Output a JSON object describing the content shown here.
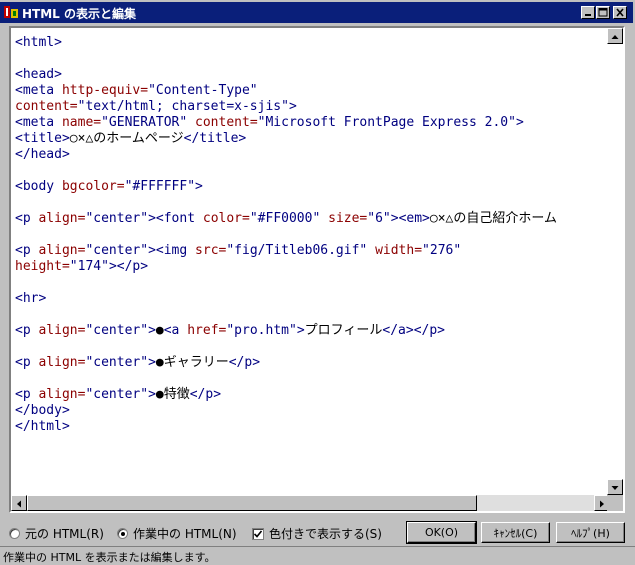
{
  "window": {
    "title": "HTML の表示と編集",
    "app_icon": "frontpage-express-icon",
    "controls": [
      "minimize-icon",
      "maximize-icon",
      "close-icon"
    ]
  },
  "colors": {
    "titlebar": "#0a1f7a",
    "tag": "#000080",
    "attribute": "#8b0000",
    "value": "#000080",
    "text": "#000000"
  },
  "editor": {
    "lines": [
      [
        {
          "t": "tag",
          "s": "<html>"
        }
      ],
      [],
      [
        {
          "t": "tag",
          "s": "<head>"
        }
      ],
      [
        {
          "t": "tag",
          "s": "<meta "
        },
        {
          "t": "attr",
          "s": "http-equiv="
        },
        {
          "t": "val",
          "s": "\"Content-Type\""
        }
      ],
      [
        {
          "t": "attr",
          "s": "content="
        },
        {
          "t": "val",
          "s": "\"text/html; charset=x-sjis\""
        },
        {
          "t": "tag",
          "s": ">"
        }
      ],
      [
        {
          "t": "tag",
          "s": "<meta "
        },
        {
          "t": "attr",
          "s": "name="
        },
        {
          "t": "val",
          "s": "\"GENERATOR\""
        },
        {
          "t": "tag",
          "s": " "
        },
        {
          "t": "attr",
          "s": "content="
        },
        {
          "t": "val",
          "s": "\"Microsoft FrontPage Express 2.0\""
        },
        {
          "t": "tag",
          "s": ">"
        }
      ],
      [
        {
          "t": "tag",
          "s": "<title>"
        },
        {
          "t": "plain",
          "s": "○×△のホームページ"
        },
        {
          "t": "tag",
          "s": "</title>"
        }
      ],
      [
        {
          "t": "tag",
          "s": "</head>"
        }
      ],
      [],
      [
        {
          "t": "tag",
          "s": "<body "
        },
        {
          "t": "attr",
          "s": "bgcolor="
        },
        {
          "t": "val",
          "s": "\"#FFFFFF\""
        },
        {
          "t": "tag",
          "s": ">"
        }
      ],
      [],
      [
        {
          "t": "tag",
          "s": "<p "
        },
        {
          "t": "attr",
          "s": "align="
        },
        {
          "t": "val",
          "s": "\"center\""
        },
        {
          "t": "tag",
          "s": "><font "
        },
        {
          "t": "attr",
          "s": "color="
        },
        {
          "t": "val",
          "s": "\"#FF0000\""
        },
        {
          "t": "tag",
          "s": " "
        },
        {
          "t": "attr",
          "s": "size="
        },
        {
          "t": "val",
          "s": "\"6\""
        },
        {
          "t": "tag",
          "s": "><em>"
        },
        {
          "t": "plain",
          "s": "○×△の自己紹介ホーム"
        }
      ],
      [],
      [
        {
          "t": "tag",
          "s": "<p "
        },
        {
          "t": "attr",
          "s": "align="
        },
        {
          "t": "val",
          "s": "\"center\""
        },
        {
          "t": "tag",
          "s": "><img "
        },
        {
          "t": "attr",
          "s": "src="
        },
        {
          "t": "val",
          "s": "\"fig/Titleb06.gif\""
        },
        {
          "t": "tag",
          "s": " "
        },
        {
          "t": "attr",
          "s": "width="
        },
        {
          "t": "val",
          "s": "\"276\""
        }
      ],
      [
        {
          "t": "attr",
          "s": "height="
        },
        {
          "t": "val",
          "s": "\"174\""
        },
        {
          "t": "tag",
          "s": "></p>"
        }
      ],
      [],
      [
        {
          "t": "tag",
          "s": "<hr>"
        }
      ],
      [],
      [
        {
          "t": "tag",
          "s": "<p "
        },
        {
          "t": "attr",
          "s": "align="
        },
        {
          "t": "val",
          "s": "\"center\""
        },
        {
          "t": "tag",
          "s": ">"
        },
        {
          "t": "plain",
          "s": "●"
        },
        {
          "t": "tag",
          "s": "<a "
        },
        {
          "t": "attr",
          "s": "href="
        },
        {
          "t": "val",
          "s": "\"pro.htm\""
        },
        {
          "t": "tag",
          "s": ">"
        },
        {
          "t": "plain",
          "s": "プロフィール"
        },
        {
          "t": "tag",
          "s": "</a></p>"
        }
      ],
      [],
      [
        {
          "t": "tag",
          "s": "<p "
        },
        {
          "t": "attr",
          "s": "align="
        },
        {
          "t": "val",
          "s": "\"center\""
        },
        {
          "t": "tag",
          "s": ">"
        },
        {
          "t": "plain",
          "s": "●ギャラリー"
        },
        {
          "t": "tag",
          "s": "</p>"
        }
      ],
      [],
      [
        {
          "t": "tag",
          "s": "<p "
        },
        {
          "t": "attr",
          "s": "align="
        },
        {
          "t": "val",
          "s": "\"center\""
        },
        {
          "t": "tag",
          "s": ">"
        },
        {
          "t": "plain",
          "s": "●特徴"
        },
        {
          "t": "tag",
          "s": "</p>"
        }
      ],
      [
        {
          "t": "tag",
          "s": "</body>"
        }
      ],
      [
        {
          "t": "tag",
          "s": "</html>"
        }
      ]
    ]
  },
  "options": {
    "original_html": "元の HTML(R)",
    "current_html": "作業中の HTML(N)",
    "color_display": "色付きで表示する(S)",
    "selected": "current_html",
    "color_checked": true
  },
  "buttons": {
    "ok": "OK(O)",
    "cancel": "ｷｬﾝｾﾙ(C)",
    "help": "ﾍﾙﾌﾟ(H)"
  },
  "status": "作業中の HTML を表示または編集します。"
}
